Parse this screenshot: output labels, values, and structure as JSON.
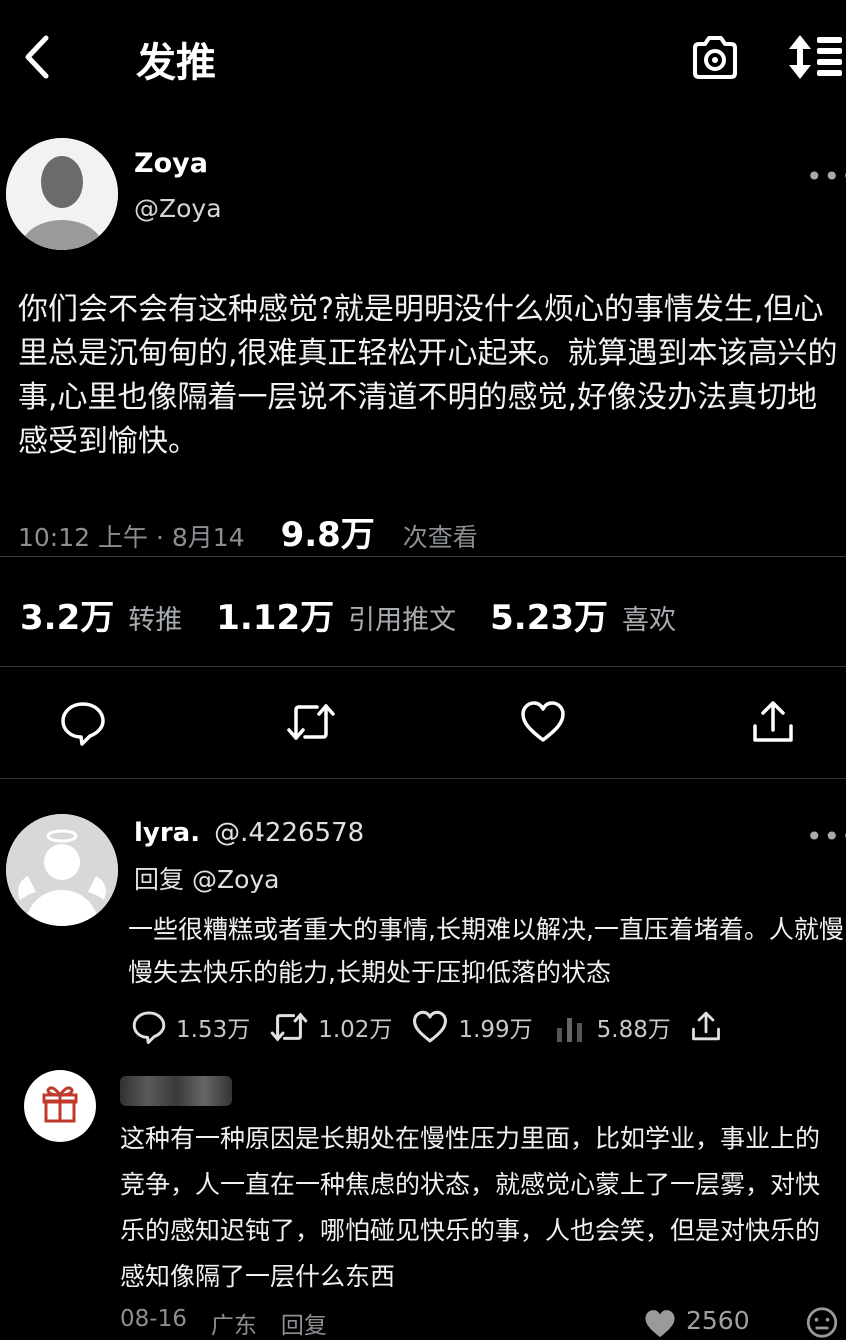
{
  "header": {
    "title": "发推"
  },
  "tweet": {
    "author_name": "Zoya",
    "author_handle": "@Zoya",
    "text": "你们会不会有这种感觉?就是明明没什么烦心的事情发生,但心里总是沉甸甸的,很难真正轻松开心起来。就算遇到本该高兴的事,心里也像隔着一层说不清道不明的感觉,好像没办法真切地感受到愉快。",
    "time": "10:12 上午 · 8月14",
    "views": "9.8万",
    "views_label": "次查看",
    "retweets": "3.2万",
    "retweets_label": "转推",
    "quotes": "1.12万",
    "quotes_label": "引用推文",
    "likes": "5.23万",
    "likes_label": "喜欢"
  },
  "reply": {
    "author_name": "lyra.",
    "author_handle": "@.4226578",
    "reply_to_prefix": "回复",
    "reply_to": "@Zoya",
    "text": "一些很糟糕或者重大的事情,长期难以解决,一直压着堵着。人就慢慢失去快乐的能力,长期处于压抑低落的状态",
    "comments": "1.53万",
    "retweets": "1.02万",
    "likes": "1.99万",
    "views": "5.88万"
  },
  "comment": {
    "text": "这种有一种原因是长期处在慢性压力里面，比如学业，事业上的竞争，人一直在一种焦虑的状态，就感觉心蒙上了一层雾，对快乐的感知迟钝了，哪怕碰见快乐的事，人也会笑，但是对快乐的感知像隔了一层什么东西",
    "date": "08-16",
    "location": "广东",
    "reply_label": "回复",
    "likes": "2560"
  },
  "icons": {
    "back": "chevron-left-icon",
    "camera": "camera-icon",
    "sort": "sort-icon",
    "more": "more-icon",
    "reply": "reply-icon",
    "retweet": "retweet-icon",
    "like": "heart-icon",
    "share": "share-icon",
    "gift": "gift-icon"
  },
  "colors": {
    "background": "#000000",
    "text": "#e7e9ea",
    "muted": "#8b8f94",
    "gift": "#c0392b"
  }
}
